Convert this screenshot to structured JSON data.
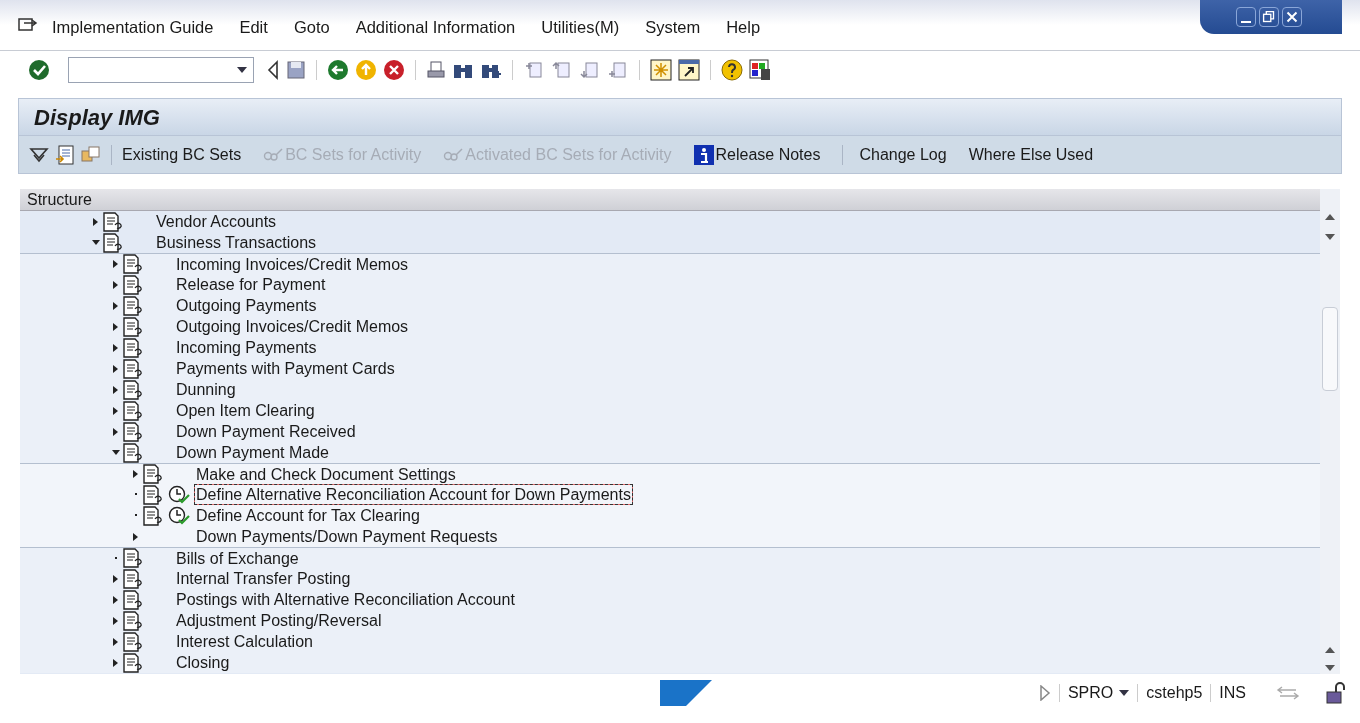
{
  "menu_bar": [
    "Implementation Guide",
    "Edit",
    "Goto",
    "Additional Information",
    "Utilities(M)",
    "System",
    "Help"
  ],
  "screen_title": "Display IMG",
  "app_toolbar": [
    {
      "label": "Existing BC Sets",
      "kind": "text",
      "disabled": false
    },
    {
      "label": "BC Sets for Activity",
      "kind": "bcset",
      "disabled": true
    },
    {
      "label": "Activated BC Sets for Activity",
      "kind": "bcset",
      "disabled": true
    },
    {
      "label": "Release Notes",
      "kind": "info",
      "disabled": false
    },
    {
      "label": "Change Log",
      "kind": "text",
      "disabled": false
    },
    {
      "label": "Where Else Used",
      "kind": "text",
      "disabled": false
    }
  ],
  "tree": {
    "header": "Structure",
    "nodes": [
      {
        "label": "Vendor Accounts",
        "expandable": true,
        "expanded": false,
        "selected": false
      },
      {
        "label": "Business Transactions",
        "expandable": true,
        "expanded": true,
        "selected": false,
        "children": [
          {
            "label": "Incoming Invoices/Credit Memos",
            "expandable": true,
            "expanded": false,
            "selected": false
          },
          {
            "label": "Release for Payment",
            "expandable": true,
            "expanded": false,
            "selected": false
          },
          {
            "label": "Outgoing Payments",
            "expandable": true,
            "expanded": false,
            "selected": false
          },
          {
            "label": "Outgoing Invoices/Credit Memos",
            "expandable": true,
            "expanded": false,
            "selected": false
          },
          {
            "label": "Incoming Payments",
            "expandable": true,
            "expanded": false,
            "selected": false
          },
          {
            "label": "Payments with Payment Cards",
            "expandable": true,
            "expanded": false,
            "selected": false
          },
          {
            "label": "Dunning",
            "expandable": true,
            "expanded": false,
            "selected": false
          },
          {
            "label": "Open Item Clearing",
            "expandable": true,
            "expanded": false,
            "selected": false
          },
          {
            "label": "Down Payment Received",
            "expandable": true,
            "expanded": false,
            "selected": false
          },
          {
            "label": "Down Payment Made",
            "expandable": true,
            "expanded": true,
            "selected": false,
            "children": [
              {
                "label": "Make and Check Document Settings",
                "kind": "folder",
                "expandable": true,
                "expanded": false,
                "selected": false
              },
              {
                "label": "Define Alternative Reconciliation Account for Down Payments",
                "kind": "activity",
                "expandable": false,
                "selected": true
              },
              {
                "label": "Define Account for Tax Clearing",
                "kind": "activity",
                "expandable": false,
                "selected": false
              },
              {
                "label": "Down Payments/Down Payment Requests",
                "kind": "plain",
                "expandable": true,
                "expanded": false,
                "selected": false
              }
            ]
          },
          {
            "label": "Bills of Exchange",
            "expandable": false,
            "selected": false
          },
          {
            "label": "Internal Transfer Posting",
            "expandable": true,
            "expanded": false,
            "selected": false
          },
          {
            "label": "Postings with Alternative Reconciliation Account",
            "expandable": true,
            "expanded": false,
            "selected": false
          },
          {
            "label": "Adjustment Posting/Reversal",
            "expandable": true,
            "expanded": false,
            "selected": false
          },
          {
            "label": "Interest Calculation",
            "expandable": true,
            "expanded": false,
            "selected": false
          },
          {
            "label": "Closing",
            "expandable": true,
            "expanded": false,
            "selected": false
          }
        ]
      }
    ]
  },
  "status_bar": {
    "transaction": "SPRO",
    "server": "cstehp5",
    "mode": "INS"
  }
}
